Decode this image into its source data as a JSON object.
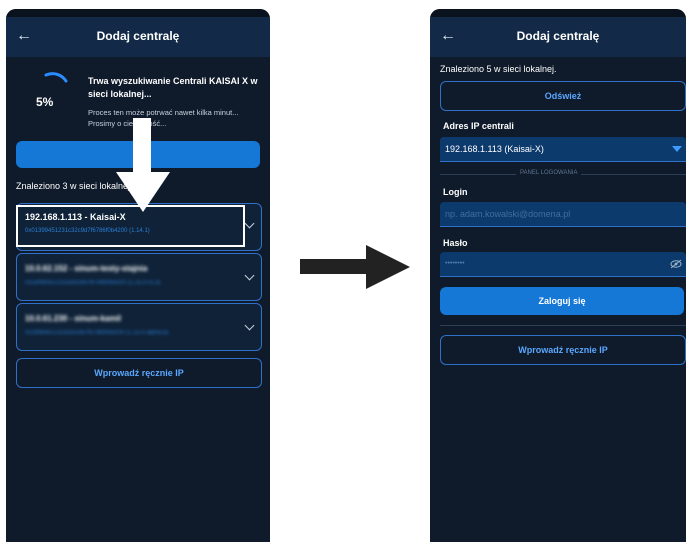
{
  "colors": {
    "background": "#0f1a2a",
    "appbar": "#122a47",
    "accent": "#1577d6",
    "link": "#3e9bff"
  },
  "left_screen": {
    "title": "Dodaj centralę",
    "back_icon": "arrow-left-icon",
    "progress_percent": "5%",
    "progress_fraction": 0.05,
    "search_title": "Trwa wyszukiwanie Centrali KAISAI X w sieci lokalnej...",
    "search_desc": "Proces ten może potrwać nawet kilka minut... Prosimy o cierpliwość...",
    "found_label": "Znaleziono 3 w sieci lokalnej.",
    "devices": [
      {
        "name": "192.168.1.113 - Kaisai-X",
        "detail": "0x01399451231c32c9d7f6786f0b4200 (1.14.1)"
      },
      {
        "name": "10.0.62.152 - sinum-testy-stajnia",
        "detail": "0x1ef9b451232a35c9d7f6786f0b4200 (1.15.0-rc.3)"
      },
      {
        "name": "10.0.61.230 - sinum-kamil",
        "detail": "0x1ff9b451232a35c9d7f6786f0b4200 (1.15.0-alpha.8)"
      }
    ],
    "manual_button": "Wprowadź ręcznie IP"
  },
  "right_screen": {
    "title": "Dodaj centralę",
    "back_icon": "arrow-left-icon",
    "found_label": "Znaleziono 5 w sieci lokalnej.",
    "refresh_button": "Odśwież",
    "ip_label": "Adres IP centrali",
    "ip_value": "192.168.1.113 (Kaisai-X)",
    "panel_label": "PANEL LOGOWANIA",
    "login_label": "Login",
    "login_placeholder": "np. adam.kowalski@domena.pl",
    "password_label": "Hasło",
    "password_value": "••••••••",
    "eye_icon": "eye-off-icon",
    "login_button": "Zaloguj się",
    "manual_button": "Wprowadź ręcznie IP"
  }
}
